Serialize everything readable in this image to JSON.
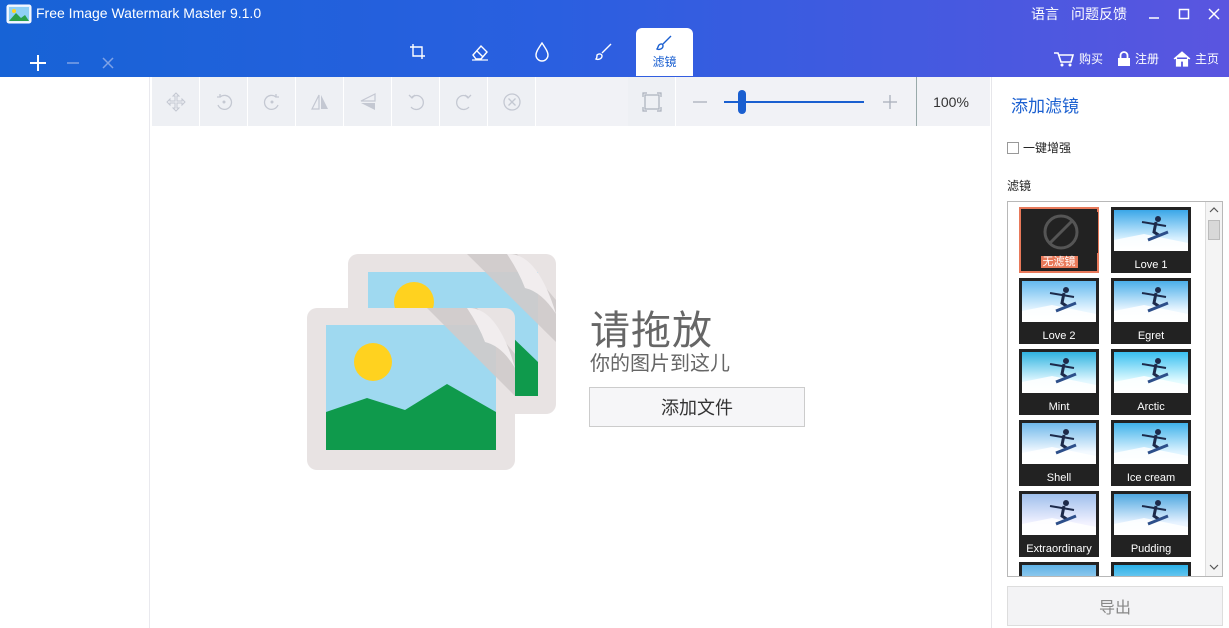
{
  "window": {
    "title": "Free Image Watermark Master 9.1.0",
    "language_label": "语言",
    "feedback_label": "问题反馈"
  },
  "header": {
    "tabs": [
      {
        "icon": "crop-icon",
        "label": ""
      },
      {
        "icon": "eraser-icon",
        "label": ""
      },
      {
        "icon": "droplet-icon",
        "label": ""
      },
      {
        "icon": "brush-icon",
        "label": ""
      },
      {
        "icon": "filter-brush-icon",
        "label": "滤镜",
        "active": true
      }
    ],
    "account": {
      "buy_label": "购买",
      "register_label": "注册",
      "home_label": "主页"
    }
  },
  "toolbar": {
    "zoom_value": "100%",
    "zoom_level": 0.13
  },
  "canvas": {
    "drop_title": "请拖放",
    "drop_subtitle": "你的图片到这儿",
    "add_file_label": "添加文件"
  },
  "panel": {
    "title": "添加滤镜",
    "enhance_label": "一键增强",
    "filters_label": "滤镜",
    "export_label": "导出",
    "filters": [
      {
        "name": "无滤镜",
        "selected": true,
        "none": true
      },
      {
        "name": "Love 1"
      },
      {
        "name": "Love 2"
      },
      {
        "name": "Egret"
      },
      {
        "name": "Mint"
      },
      {
        "name": "Arctic"
      },
      {
        "name": "Shell"
      },
      {
        "name": "Ice cream"
      },
      {
        "name": "Extraordinary"
      },
      {
        "name": "Pudding"
      }
    ]
  },
  "colors": {
    "accent": "#1a5fd0",
    "selected_border": "#e8795a"
  }
}
